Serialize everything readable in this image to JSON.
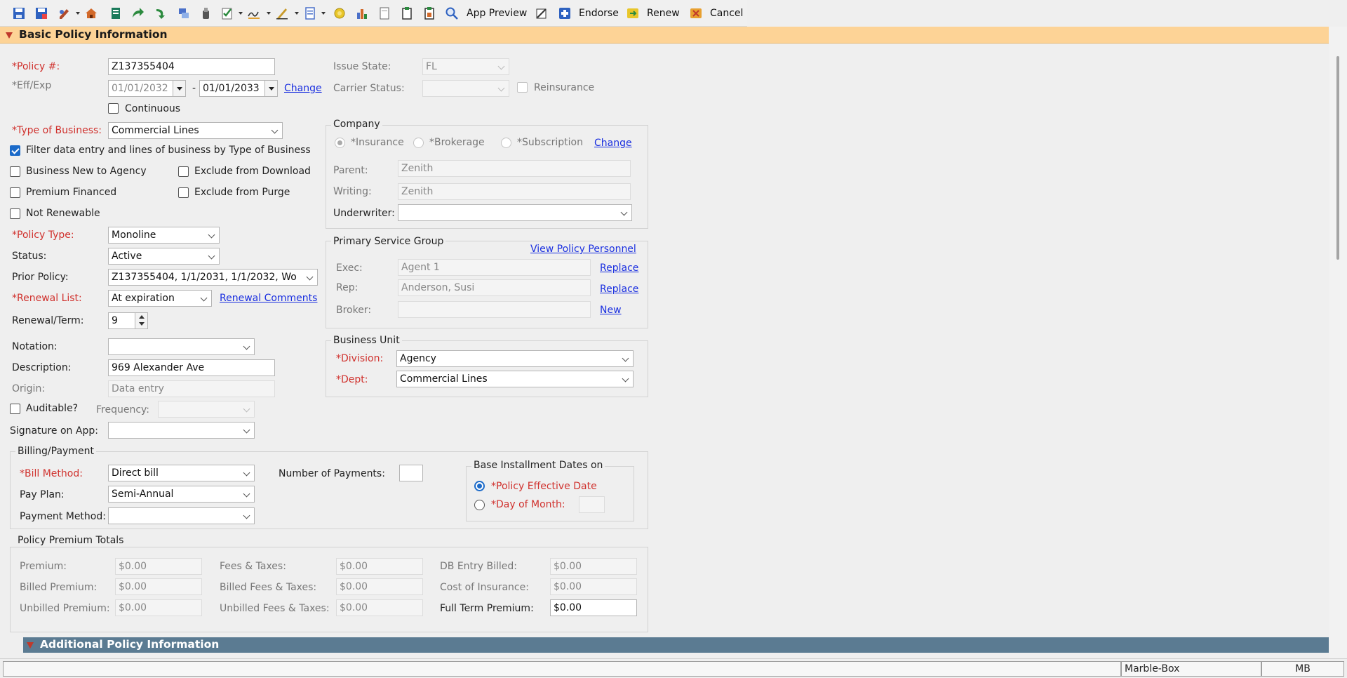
{
  "toolbar": {
    "app_preview": "App Preview",
    "endorse": "Endorse",
    "renew": "Renew",
    "cancel": "Cancel"
  },
  "section_basic": "Basic Policy Information",
  "section_additional": "Additional Policy Information",
  "left": {
    "policy_label": "*Policy #:",
    "policy_value": "Z137355404",
    "effexp_label": "*Eff/Exp",
    "eff_value": "01/01/2032",
    "sep": "-",
    "exp_value": "01/01/2033",
    "change": "Change",
    "continuous": "Continuous",
    "type_label": "*Type of Business:",
    "type_value": "Commercial Lines",
    "filter": "Filter data entry and lines of business by Type of Business",
    "new_to_agency": "Business New to Agency",
    "exclude_download": "Exclude from Download",
    "premium_financed": "Premium Financed",
    "exclude_purge": "Exclude from Purge",
    "not_renewable": "Not Renewable",
    "policy_type_label": "*Policy Type:",
    "policy_type_value": "Monoline",
    "status_label": "Status:",
    "status_value": "Active",
    "prior_label": "Prior Policy:",
    "prior_value": "Z137355404, 1/1/2031, 1/1/2032, Wo",
    "renewal_list_label": "*Renewal List:",
    "renewal_list_value": "At expiration",
    "renewal_comments": "Renewal Comments",
    "renewal_term_label": "Renewal/Term:",
    "renewal_term_value": "9",
    "notation_label": "Notation:",
    "notation_value": "",
    "description_label": "Description:",
    "description_value": "969 Alexander Ave",
    "origin_label": "Origin:",
    "origin_value": "Data entry",
    "auditable": "Auditable?",
    "frequency_label": "Frequency:",
    "frequency_value": "",
    "signature_label": "Signature on App:",
    "signature_value": ""
  },
  "right": {
    "issue_state_label": "Issue State:",
    "issue_state_value": "FL",
    "carrier_status_label": "Carrier Status:",
    "carrier_status_value": "",
    "reinsurance": "Reinsurance",
    "company_title": "Company",
    "insurance": "*Insurance",
    "brokerage": "*Brokerage",
    "subscription": "*Subscription",
    "change": "Change",
    "parent_label": "Parent:",
    "parent_value": "Zenith",
    "writing_label": "Writing:",
    "writing_value": "Zenith",
    "underwriter_label": "Underwriter:",
    "underwriter_value": "",
    "psg_title": "Primary Service Group",
    "view_personnel": "View Policy Personnel",
    "exec_label": "Exec:",
    "exec_value": "Agent 1",
    "replace": "Replace",
    "rep_label": "Rep:",
    "rep_value": "Anderson, Susi",
    "broker_label": "Broker:",
    "broker_value": "",
    "new": "New",
    "bu_title": "Business Unit",
    "division_label": "*Division:",
    "division_value": "Agency",
    "dept_label": "*Dept:",
    "dept_value": "Commercial Lines"
  },
  "billing": {
    "title": "Billing/Payment",
    "bill_method_label": "*Bill Method:",
    "bill_method_value": "Direct bill",
    "num_payments_label": "Number of Payments:",
    "num_payments_value": "",
    "pay_plan_label": "Pay Plan:",
    "pay_plan_value": "Semi-Annual",
    "payment_method_label": "Payment Method:",
    "payment_method_value": "",
    "base_title": "Base Installment Dates on",
    "policy_eff_date": "*Policy Effective Date",
    "day_of_month": "*Day of Month:",
    "day_value": ""
  },
  "totals": {
    "title": "Policy Premium Totals",
    "premium_label": "Premium:",
    "premium_value": "$0.00",
    "billed_premium_label": "Billed Premium:",
    "billed_premium_value": "$0.00",
    "unbilled_premium_label": "Unbilled Premium:",
    "unbilled_premium_value": "$0.00",
    "fees_label": "Fees & Taxes:",
    "fees_value": "$0.00",
    "billed_fees_label": "Billed Fees & Taxes:",
    "billed_fees_value": "$0.00",
    "unbilled_fees_label": "Unbilled Fees & Taxes:",
    "unbilled_fees_value": "$0.00",
    "db_entry_label": "DB Entry Billed:",
    "db_entry_value": "$0.00",
    "cost_ins_label": "Cost of Insurance:",
    "cost_ins_value": "$0.00",
    "full_term_label": "Full Term Premium:",
    "full_term_value": "$0.00"
  },
  "statusbar": {
    "left": "",
    "mid": "Marble-Box",
    "right": "MB"
  },
  "icons": [
    "save-icon",
    "save-as-icon",
    "edit-icon",
    "home-icon",
    "ledger-icon",
    "forward-icon",
    "redo-icon",
    "transfer-icon",
    "attach-icon",
    "checklist-icon",
    "signature-icon",
    "pen-icon",
    "document-icon",
    "coin-icon",
    "chart-icon",
    "page-icon",
    "copy-icon",
    "paste-icon",
    "search-icon",
    "app-preview-icon",
    "endorse-icon",
    "renew-icon",
    "cancel-icon"
  ]
}
